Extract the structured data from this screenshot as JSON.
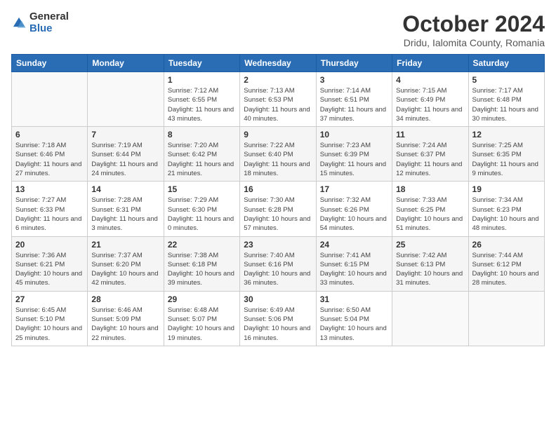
{
  "header": {
    "logo_general": "General",
    "logo_blue": "Blue",
    "month_title": "October 2024",
    "location": "Dridu, Ialomita County, Romania"
  },
  "days_of_week": [
    "Sunday",
    "Monday",
    "Tuesday",
    "Wednesday",
    "Thursday",
    "Friday",
    "Saturday"
  ],
  "weeks": [
    [
      {
        "num": "",
        "detail": ""
      },
      {
        "num": "",
        "detail": ""
      },
      {
        "num": "1",
        "detail": "Sunrise: 7:12 AM\nSunset: 6:55 PM\nDaylight: 11 hours and 43 minutes."
      },
      {
        "num": "2",
        "detail": "Sunrise: 7:13 AM\nSunset: 6:53 PM\nDaylight: 11 hours and 40 minutes."
      },
      {
        "num": "3",
        "detail": "Sunrise: 7:14 AM\nSunset: 6:51 PM\nDaylight: 11 hours and 37 minutes."
      },
      {
        "num": "4",
        "detail": "Sunrise: 7:15 AM\nSunset: 6:49 PM\nDaylight: 11 hours and 34 minutes."
      },
      {
        "num": "5",
        "detail": "Sunrise: 7:17 AM\nSunset: 6:48 PM\nDaylight: 11 hours and 30 minutes."
      }
    ],
    [
      {
        "num": "6",
        "detail": "Sunrise: 7:18 AM\nSunset: 6:46 PM\nDaylight: 11 hours and 27 minutes."
      },
      {
        "num": "7",
        "detail": "Sunrise: 7:19 AM\nSunset: 6:44 PM\nDaylight: 11 hours and 24 minutes."
      },
      {
        "num": "8",
        "detail": "Sunrise: 7:20 AM\nSunset: 6:42 PM\nDaylight: 11 hours and 21 minutes."
      },
      {
        "num": "9",
        "detail": "Sunrise: 7:22 AM\nSunset: 6:40 PM\nDaylight: 11 hours and 18 minutes."
      },
      {
        "num": "10",
        "detail": "Sunrise: 7:23 AM\nSunset: 6:39 PM\nDaylight: 11 hours and 15 minutes."
      },
      {
        "num": "11",
        "detail": "Sunrise: 7:24 AM\nSunset: 6:37 PM\nDaylight: 11 hours and 12 minutes."
      },
      {
        "num": "12",
        "detail": "Sunrise: 7:25 AM\nSunset: 6:35 PM\nDaylight: 11 hours and 9 minutes."
      }
    ],
    [
      {
        "num": "13",
        "detail": "Sunrise: 7:27 AM\nSunset: 6:33 PM\nDaylight: 11 hours and 6 minutes."
      },
      {
        "num": "14",
        "detail": "Sunrise: 7:28 AM\nSunset: 6:31 PM\nDaylight: 11 hours and 3 minutes."
      },
      {
        "num": "15",
        "detail": "Sunrise: 7:29 AM\nSunset: 6:30 PM\nDaylight: 11 hours and 0 minutes."
      },
      {
        "num": "16",
        "detail": "Sunrise: 7:30 AM\nSunset: 6:28 PM\nDaylight: 10 hours and 57 minutes."
      },
      {
        "num": "17",
        "detail": "Sunrise: 7:32 AM\nSunset: 6:26 PM\nDaylight: 10 hours and 54 minutes."
      },
      {
        "num": "18",
        "detail": "Sunrise: 7:33 AM\nSunset: 6:25 PM\nDaylight: 10 hours and 51 minutes."
      },
      {
        "num": "19",
        "detail": "Sunrise: 7:34 AM\nSunset: 6:23 PM\nDaylight: 10 hours and 48 minutes."
      }
    ],
    [
      {
        "num": "20",
        "detail": "Sunrise: 7:36 AM\nSunset: 6:21 PM\nDaylight: 10 hours and 45 minutes."
      },
      {
        "num": "21",
        "detail": "Sunrise: 7:37 AM\nSunset: 6:20 PM\nDaylight: 10 hours and 42 minutes."
      },
      {
        "num": "22",
        "detail": "Sunrise: 7:38 AM\nSunset: 6:18 PM\nDaylight: 10 hours and 39 minutes."
      },
      {
        "num": "23",
        "detail": "Sunrise: 7:40 AM\nSunset: 6:16 PM\nDaylight: 10 hours and 36 minutes."
      },
      {
        "num": "24",
        "detail": "Sunrise: 7:41 AM\nSunset: 6:15 PM\nDaylight: 10 hours and 33 minutes."
      },
      {
        "num": "25",
        "detail": "Sunrise: 7:42 AM\nSunset: 6:13 PM\nDaylight: 10 hours and 31 minutes."
      },
      {
        "num": "26",
        "detail": "Sunrise: 7:44 AM\nSunset: 6:12 PM\nDaylight: 10 hours and 28 minutes."
      }
    ],
    [
      {
        "num": "27",
        "detail": "Sunrise: 6:45 AM\nSunset: 5:10 PM\nDaylight: 10 hours and 25 minutes."
      },
      {
        "num": "28",
        "detail": "Sunrise: 6:46 AM\nSunset: 5:09 PM\nDaylight: 10 hours and 22 minutes."
      },
      {
        "num": "29",
        "detail": "Sunrise: 6:48 AM\nSunset: 5:07 PM\nDaylight: 10 hours and 19 minutes."
      },
      {
        "num": "30",
        "detail": "Sunrise: 6:49 AM\nSunset: 5:06 PM\nDaylight: 10 hours and 16 minutes."
      },
      {
        "num": "31",
        "detail": "Sunrise: 6:50 AM\nSunset: 5:04 PM\nDaylight: 10 hours and 13 minutes."
      },
      {
        "num": "",
        "detail": ""
      },
      {
        "num": "",
        "detail": ""
      }
    ]
  ]
}
